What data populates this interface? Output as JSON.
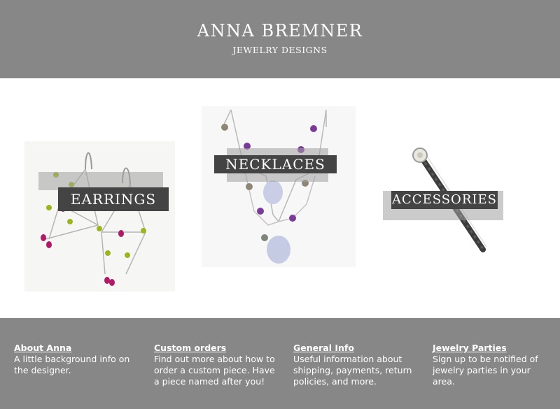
{
  "header": {
    "brand_name": "ANNA BREMNER",
    "brand_subtitle": "JEWELRY DESIGNS"
  },
  "gallery": {
    "earrings": {
      "label": "EARRINGS"
    },
    "necklaces": {
      "label": "NECKLACES"
    },
    "accessories": {
      "label": "ACCESSORIES"
    }
  },
  "footer": {
    "about": {
      "title": "About Anna",
      "text": "A little background info on the designer."
    },
    "custom": {
      "title": "Custom orders",
      "text": "Find out more about how to order a custom piece. Have a piece named after you!"
    },
    "general": {
      "title": "General Info",
      "text": "Useful information about shipping, payments, return policies, and more."
    },
    "parties": {
      "title": "Jewelry Parties",
      "text": "Sign up to be notified of jewelry parties in your area."
    }
  },
  "colors": {
    "header_bg": "#878787",
    "footer_bg": "#878787",
    "label_bg": "#444444"
  }
}
